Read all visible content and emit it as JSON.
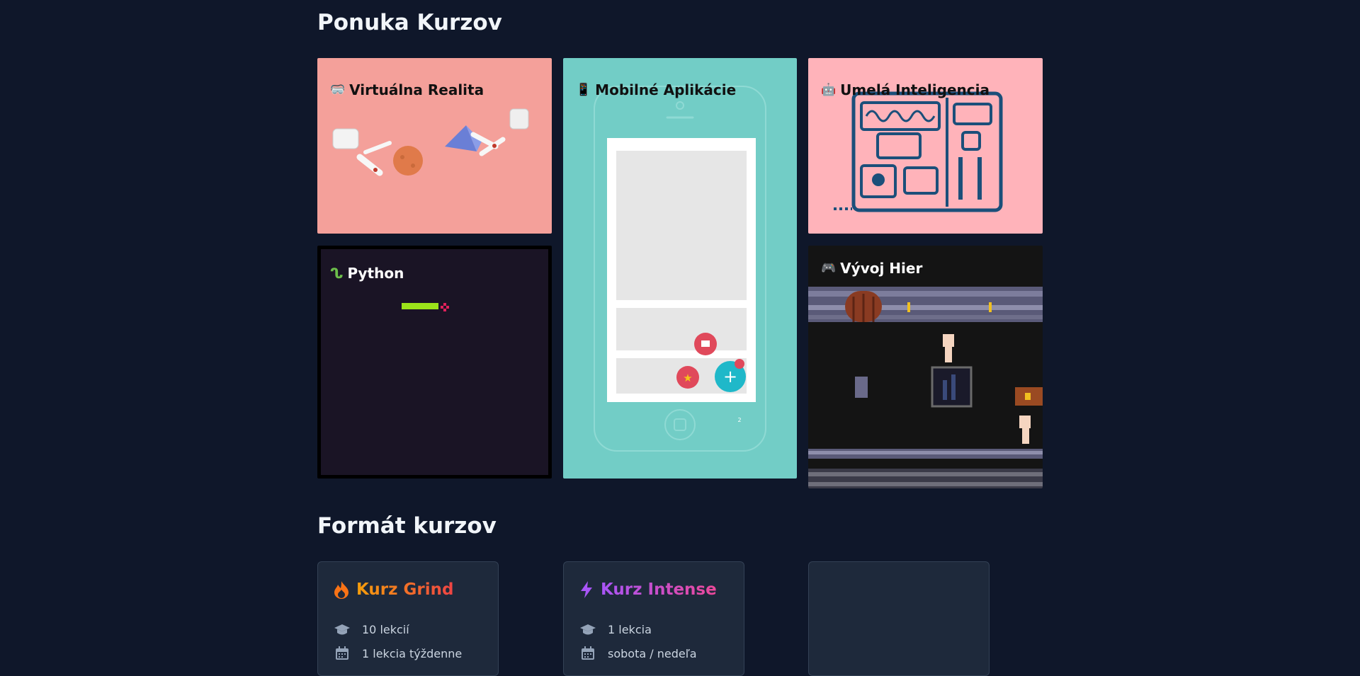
{
  "sections": {
    "courses_title": "Ponuka Kurzov",
    "formats_title": "Formát kurzov"
  },
  "courses": [
    {
      "key": "vr",
      "icon": "vr-goggles-icon",
      "emoji": "🥽",
      "title": "Virtuálna Realita",
      "bg": "#f4a09a"
    },
    {
      "key": "mobile",
      "icon": "mobile-phone-icon",
      "emoji": "📱",
      "title": "Mobilné Aplikácie",
      "bg": "#72cdc6"
    },
    {
      "key": "ai",
      "icon": "robot-icon",
      "emoji": "🤖",
      "title": "Umelá Inteligencia",
      "bg": "#ffb3ba"
    },
    {
      "key": "python",
      "icon": "python-icon",
      "emoji": "",
      "title": "Python",
      "bg": "#1a1425"
    },
    {
      "key": "games",
      "icon": "game-controller-icon",
      "emoji": "🎮",
      "title": "Vývoj Hier",
      "bg": "#141414"
    }
  ],
  "phone_badge": "2",
  "formats": [
    {
      "title": "Kurz Grind",
      "icon": "fire-icon",
      "color_from": "#f59e0b",
      "color_to": "#ef4444",
      "rows": [
        {
          "icon": "graduation-cap-icon",
          "text": "10 lekcií"
        },
        {
          "icon": "calendar-icon",
          "text": "1 lekcia týždenne"
        }
      ]
    },
    {
      "title": "Kurz Intense",
      "icon": "lightning-icon",
      "color_from": "#a855f7",
      "color_to": "#ec4899",
      "rows": [
        {
          "icon": "graduation-cap-icon",
          "text": "1 lekcia"
        },
        {
          "icon": "calendar-icon",
          "text": "sobota / nedeľa"
        }
      ]
    },
    {
      "title": "",
      "icon": "",
      "rows": []
    }
  ]
}
